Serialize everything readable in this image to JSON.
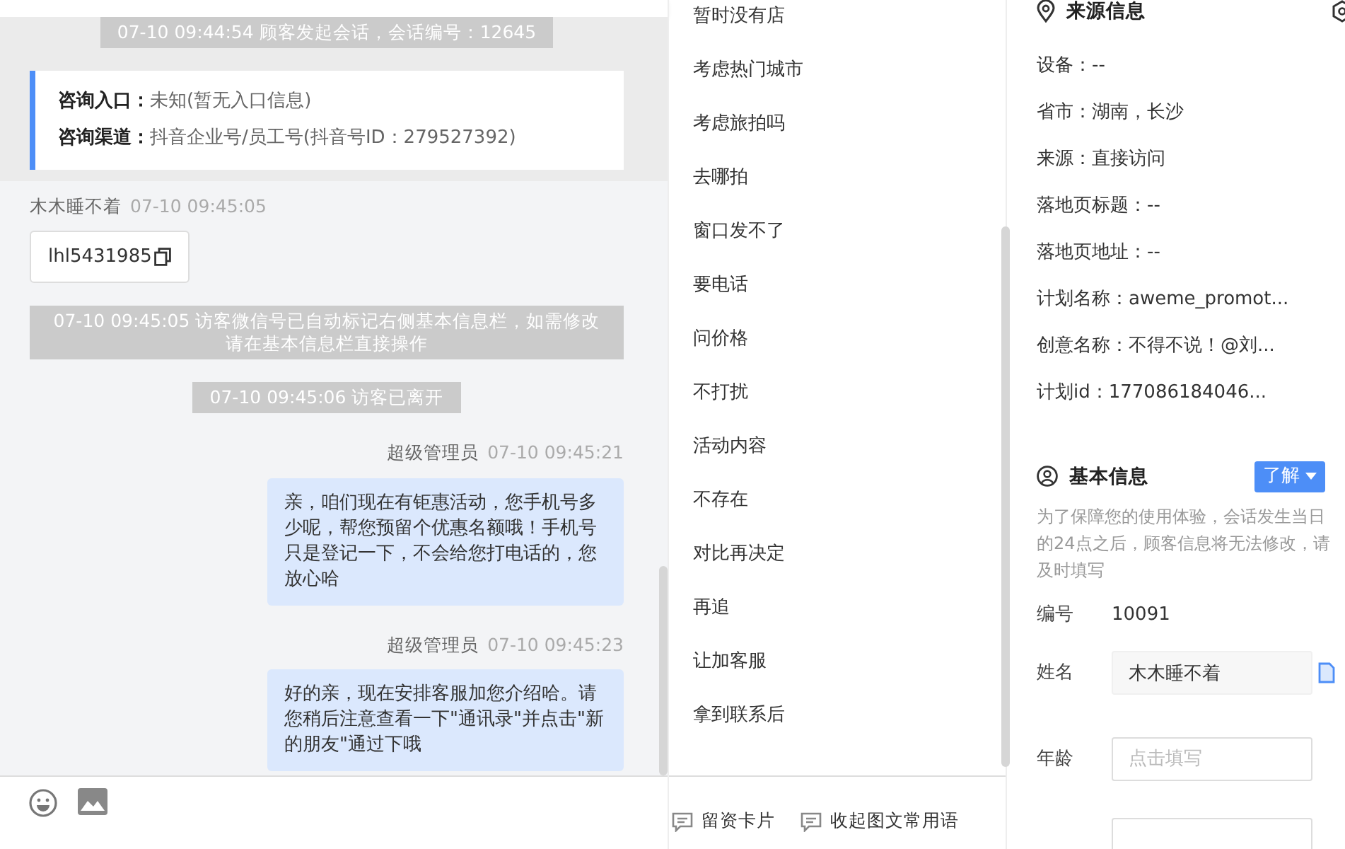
{
  "chat": {
    "messages": [
      {
        "kind": "system",
        "banner": true,
        "text": "07-10 09:44:54 顾客发起会话，会话编号：12645"
      },
      {
        "kind": "entry_card",
        "rows": [
          {
            "label": "咨询入口：",
            "value": "未知(暂无入口信息)"
          },
          {
            "label": "咨询渠道：",
            "value": "抖音企业号/员工号(抖音号ID：279527392)"
          }
        ]
      },
      {
        "kind": "visitor",
        "sender": "木木睡不着",
        "time": "07-10 09:45:05",
        "text": "lhl5431985"
      },
      {
        "kind": "system",
        "banner": false,
        "text": "07-10 09:45:05 访客微信号已自动标记右侧基本信息栏，如需修改请在基本信息栏直接操作"
      },
      {
        "kind": "system",
        "banner": false,
        "text": "07-10 09:45:06 访客已离开"
      },
      {
        "kind": "agent",
        "sender": "超级管理员",
        "time": "07-10 09:45:21",
        "text": "亲，咱们现在有钜惠活动，您手机号多少呢，帮您预留个优惠名额哦！手机号只是登记一下，不会给您打电话的，您放心哈"
      },
      {
        "kind": "agent",
        "sender": "超级管理员",
        "time": "07-10 09:45:23",
        "text": "好的亲，现在安排客服加您介绍哈。请您稍后注意查看一下\"通讯录\"并点击\"新的朋友\"通过下哦"
      }
    ]
  },
  "quick_replies": {
    "items": [
      "暂时没有店",
      "考虑热门城市",
      "考虑旅拍吗",
      "去哪拍",
      "窗口发不了",
      "要电话",
      "问价格",
      "不打扰",
      "活动内容",
      "不存在",
      "对比再决定",
      "再追",
      "让加客服",
      "拿到联系后"
    ],
    "footer_buttons": [
      "留资卡片",
      "收起图文常用语"
    ]
  },
  "source_info": {
    "title": "来源信息",
    "fields": [
      "设备：--",
      "省市：湖南，长沙",
      "来源：直接访问",
      "落地页标题：--",
      "落地页地址：--",
      "计划名称：aweme_promot...",
      "创意名称：不得不说！@刘...",
      "计划id：177086184046..."
    ]
  },
  "basic_info": {
    "title": "基本信息",
    "dropdown": "了解",
    "notice": "为了保障您的使用体验，会话发生当日的24点之后，顾客信息将无法修改，请及时填写",
    "fields": [
      {
        "kind": "text",
        "label": "编号",
        "value": "10091"
      },
      {
        "kind": "filled",
        "label": "姓名",
        "value": "木木睡不着"
      },
      {
        "kind": "input",
        "label": "年龄",
        "placeholder": "点击填写"
      }
    ]
  }
}
